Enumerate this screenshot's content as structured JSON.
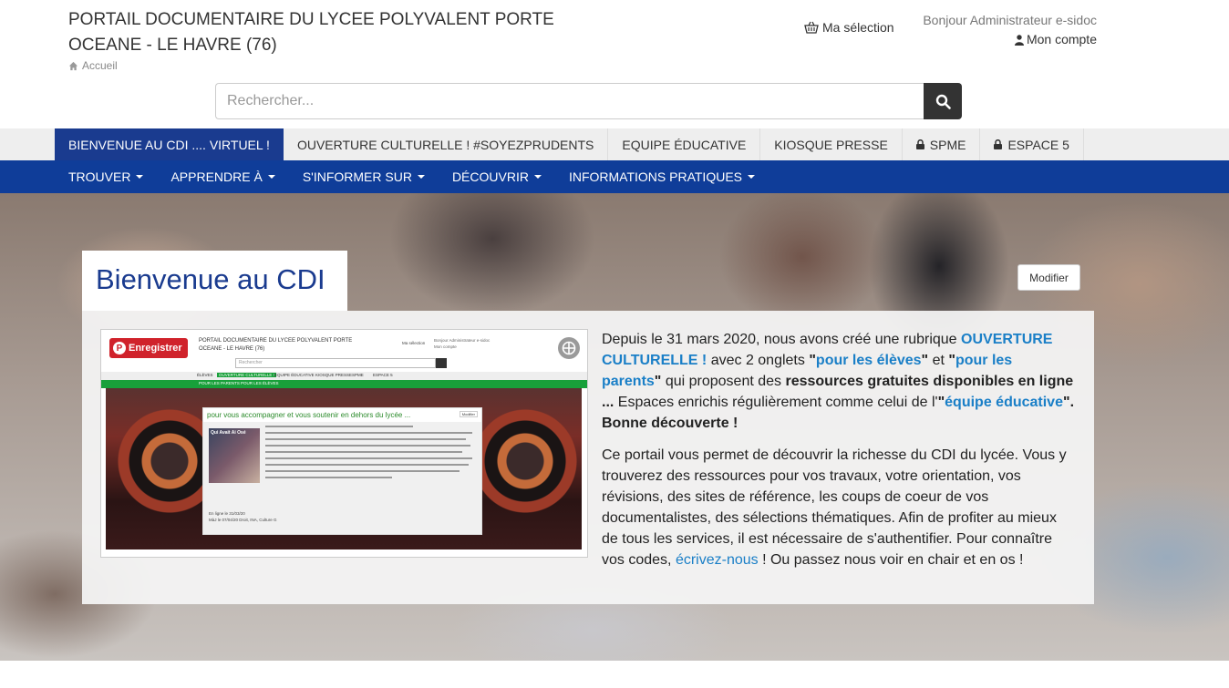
{
  "header": {
    "title": "PORTAIL DOCUMENTAIRE DU LYCEE POLYVALENT PORTE OCEANE - LE HAVRE (76)",
    "breadcrumb": "Accueil",
    "selection": "Ma sélection",
    "greeting": "Bonjour Administrateur e-sidoc",
    "account": "Mon compte"
  },
  "search": {
    "placeholder": "Rechercher..."
  },
  "tabs": [
    {
      "label": "BIENVENUE AU CDI .... VIRTUEL !",
      "active": true,
      "locked": false
    },
    {
      "label": "OUVERTURE CULTURELLE ! #SOYEZPRUDENTS",
      "active": false,
      "locked": false
    },
    {
      "label": "EQUIPE ÉDUCATIVE",
      "active": false,
      "locked": false
    },
    {
      "label": "KIOSQUE PRESSE",
      "active": false,
      "locked": false
    },
    {
      "label": "SPME",
      "active": false,
      "locked": true
    },
    {
      "label": "ESPACE 5",
      "active": false,
      "locked": true
    }
  ],
  "nav": [
    {
      "label": "TROUVER"
    },
    {
      "label": "APPRENDRE À"
    },
    {
      "label": "S'INFORMER SUR"
    },
    {
      "label": "DÉCOUVRIR"
    },
    {
      "label": "INFORMATIONS PRATIQUES"
    }
  ],
  "hero": {
    "title": "Bienvenue au CDI",
    "edit_label": "Modifier"
  },
  "thumbnail": {
    "pin_label": "Enregistrer",
    "pin_letter": "P",
    "title": "PORTAIL DOCUMENTAIRE DU LYCEE POLYVALENT PORTE OCEANE - LE HAVRE (76)",
    "selection": "Ma sélection",
    "greeting": "Bonjour Administrateur e-sidoc",
    "account": "Mon compte",
    "search": "Rechercher",
    "tabs": [
      "ÉLÈVES",
      "OUVERTURE CULTURELLE !",
      "EQUIPE ÉDUCATIVE",
      "KIOSQUE PRESSE",
      "SPME",
      "ESPACE 5"
    ],
    "nav": [
      "POUR LES PARENTS",
      "POUR LES ÉLÈVES"
    ],
    "card_title": "pour vous accompagner et vous soutenir en dehors du lycée ...",
    "card_edit": "Modifier",
    "image_label": "Qui Avait Ai Osé",
    "online_date": "En ligne le 31/03/20",
    "updated": "MàJ le 07/04/20   Droit, INA, Culture G"
  },
  "description": {
    "p1_a": "Depuis le 31 mars 2020, nous avons créé une rubrique ",
    "p1_link1": "OUVERTURE CULTURELLE !",
    "p1_b": " avec 2 onglets ",
    "p1_q1a": "\"",
    "p1_link2": "pour les élèves",
    "p1_q1b": "\"",
    "p1_c": " et ",
    "p1_q2a": "\"",
    "p1_link3": "pour les parents",
    "p1_q2b": "\"",
    "p1_d": "  qui proposent des ",
    "p1_bold1": "ressources gratuites disponibles en ligne ...",
    "p1_e": " Espaces enrichis régulièrement comme celui de l'",
    "p1_q3a": "\"",
    "p1_link4": "équipe éducative",
    "p1_q3b": "\"",
    "p1_bold2": ". Bonne découverte !",
    "p2_a": "Ce portail vous permet de découvrir la richesse du CDI du lycée. Vous y trouverez des ressources pour vos travaux, votre orientation, vos révisions, des sites de référence, les coups de coeur de vos documentalistes, des sélections thématiques. Afin de profiter au mieux de tous les services, il est nécessaire de s'authentifier. Pour connaître vos codes, ",
    "p2_link": "écrivez-nous",
    "p2_b": " ! Ou passez nous voir en chair et en os !"
  },
  "colors": {
    "tab_active": "#1a3b8f",
    "navbar": "#0f3d99",
    "title": "#1a3b8f",
    "link": "#1a7fc7",
    "pin": "#d0222b"
  }
}
